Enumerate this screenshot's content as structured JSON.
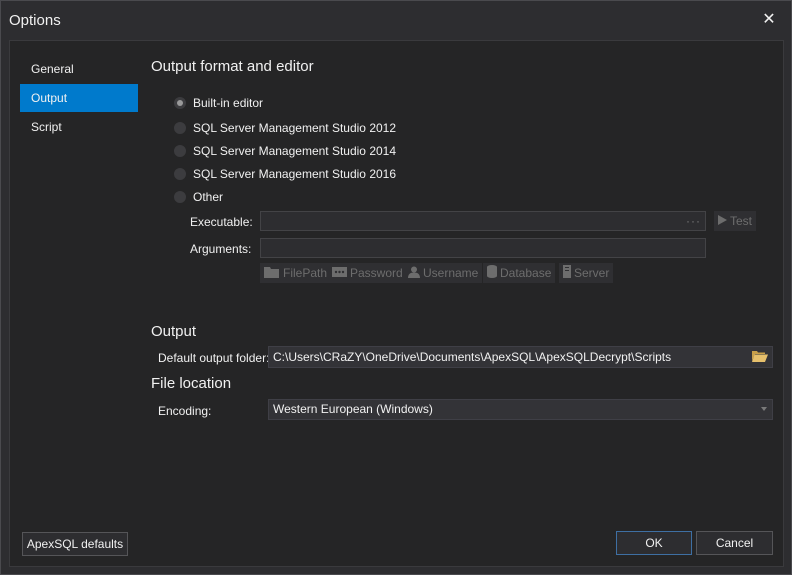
{
  "window": {
    "title": "Options",
    "close_symbol": "✕"
  },
  "nav": {
    "items": [
      {
        "label": "General"
      },
      {
        "label": "Output"
      },
      {
        "label": "Script"
      }
    ]
  },
  "output_format": {
    "heading": "Output format and editor",
    "options": [
      {
        "label": "Built-in editor",
        "checked": true
      },
      {
        "label": "SQL Server Management Studio 2012",
        "checked": false
      },
      {
        "label": "SQL Server Management Studio 2014",
        "checked": false
      },
      {
        "label": "SQL Server Management Studio 2016",
        "checked": false
      },
      {
        "label": "Other",
        "checked": false
      }
    ],
    "executable_label": "Executable:",
    "executable_value": "",
    "browse_dots": "···",
    "test_label": "Test",
    "arguments_label": "Arguments:",
    "arguments_value": "",
    "tokens": [
      {
        "label": "FilePath",
        "icon": "folder-icon"
      },
      {
        "label": "Password",
        "icon": "password-icon"
      },
      {
        "label": "Username",
        "icon": "user-icon"
      },
      {
        "label": "Database",
        "icon": "database-icon"
      },
      {
        "label": "Server",
        "icon": "server-icon"
      }
    ]
  },
  "output": {
    "heading": "Output",
    "folder_label": "Default output folder:",
    "folder_value": "C:\\Users\\CRaZY\\OneDrive\\Documents\\ApexSQL\\ApexSQLDecrypt\\Scripts"
  },
  "file_location": {
    "heading": "File location",
    "encoding_label": "Encoding:",
    "encoding_value": "Western European (Windows)"
  },
  "footer": {
    "defaults_label": "ApexSQL defaults",
    "ok_label": "OK",
    "cancel_label": "Cancel"
  },
  "colors": {
    "accent": "#007acc",
    "background": "#2d2d30",
    "panel": "#252526"
  }
}
